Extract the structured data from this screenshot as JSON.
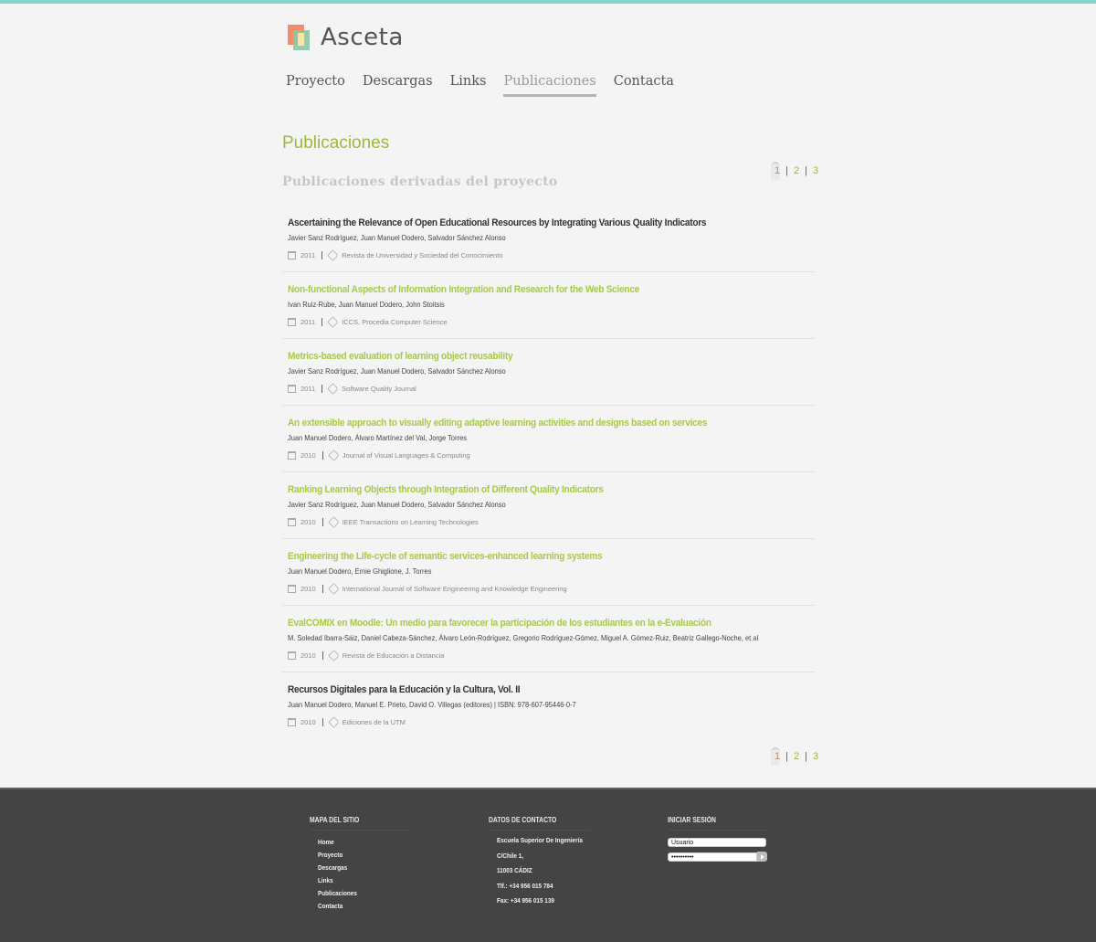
{
  "brand": {
    "name": "Asceta"
  },
  "nav": [
    {
      "label": "Proyecto"
    },
    {
      "label": "Descargas"
    },
    {
      "label": "Links"
    },
    {
      "label": "Publicaciones",
      "active": true
    },
    {
      "label": "Contacta"
    }
  ],
  "page": {
    "title": "Publicaciones",
    "subtitle": "Publicaciones derivadas del proyecto"
  },
  "pagination": {
    "pages": [
      "1",
      "2",
      "3"
    ],
    "current": "1"
  },
  "publications": [
    {
      "title": "Ascertaining the Relevance of Open Educational Resources by Integrating Various Quality Indicators",
      "authors": "Javier Sanz Rodríguez, Juan Manuel Dodero, Salvador Sánchez Alonso",
      "year": "2011",
      "venue": "Revista de Universidad y Sociedad del Conocimiento",
      "link": false
    },
    {
      "title": "Non-functional Aspects of Information Integration and Research for the Web Science",
      "authors": "Ivan Ruiz-Rube, Juan Manuel Dodero, John Stoitsis",
      "year": "2011",
      "venue": "ICCS, Procedia Computer Science",
      "link": true
    },
    {
      "title": "Metrics-based evaluation of learning object reusability",
      "authors": "Javier Sanz Rodríguez, Juan Manuel Dodero, Salvador Sánchez Alonso",
      "year": "2011",
      "venue": "Software Quality Journal",
      "link": true
    },
    {
      "title": "An extensible approach to visually editing adaptive learning activities and designs based on services",
      "authors": "Juan Manuel Dodero, Álvaro Martínez del Val, Jorge Torres",
      "year": "2010",
      "venue": "Journal of Visual Languages & Computing",
      "link": true
    },
    {
      "title": "Ranking Learning Objects through Integration of Different Quality Indicators",
      "authors": "Javier Sanz Rodríguez, Juan Manuel Dodero, Salvador Sánchez Alonso",
      "year": "2010",
      "venue": "IEEE Transactions on Learning Technologies",
      "link": true
    },
    {
      "title": "Engineering the Life-cycle of semantic services-enhanced learning systems",
      "authors": "Juan Manuel Dodero, Ernie Ghiglione, J. Torres",
      "year": "2010",
      "venue": "International Journal of Software Engineering and Knowledge Engineering",
      "link": true
    },
    {
      "title": "EvalCOMIX en Moodle: Un medio para favorecer la participación de los estudiantes en la e-Evaluación",
      "authors": "M. Soledad Ibarra-Sáiz, Daniel Cabeza-Sánchez, Álvaro León-Rodríguez, Gregorio Rodríguez-Gómez, Miguel A. Gómez-Ruiz, Beatriz Gallego-Noche, et al",
      "year": "2010",
      "venue": "Revista de Educación a Distancia",
      "link": true
    },
    {
      "title": "Recursos Digitales para la Educación y la Cultura, Vol. II",
      "authors": "Juan Manuel Dodero, Manuel E. Prieto, David O. Villegas (editores) | ISBN: 978-607-95446-0-7",
      "year": "2010",
      "venue": "Ediciones de la UTM",
      "link": false
    }
  ],
  "footer": {
    "sitemap": {
      "heading": "MAPA DEL SITIO",
      "items": [
        "Home",
        "Proyecto",
        "Descargas",
        "Links",
        "Publicaciones",
        "Contacta"
      ]
    },
    "contact": {
      "heading": "DATOS DE CONTACTO",
      "lines": [
        "Escuela Superior De Ingeniería",
        "C/Chile 1,",
        "11003 CÁDIZ",
        "Tlf.: +34 956 015 784",
        "Fax: +34 956 015 139"
      ]
    },
    "login": {
      "heading": "INICIAR SESIÓN",
      "username_value": "Usuario",
      "password_value": "••••••••••"
    }
  },
  "colors": {
    "accent": "#9bb83f",
    "current_page": "#e3855e",
    "top_line": "#86d4c8",
    "footer_bg": "#444444"
  }
}
